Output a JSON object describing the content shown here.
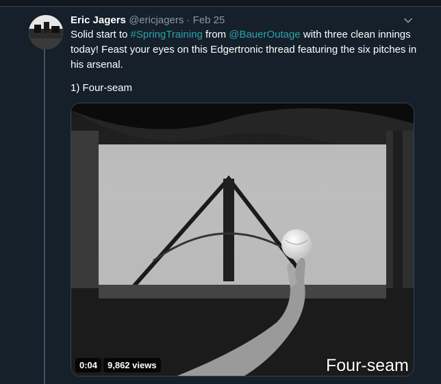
{
  "tweet": {
    "author_name": "Eric Jagers",
    "author_handle": "@ericjagers",
    "separator": "·",
    "date": "Feb 25",
    "text_parts": {
      "p1": "Solid start to ",
      "hashtag": "#SpringTraining",
      "p2": " from ",
      "mention": "@BauerOutage",
      "p3": " with three clean innings today! Feast your eyes on this Edgertronic thread featuring the six pitches in his arsenal."
    },
    "subline": "1) Four-seam"
  },
  "media": {
    "duration": "0:04",
    "views": "9,862 views",
    "caption": "Four-seam"
  },
  "icons": {
    "caret": "chevron-down-icon"
  },
  "colors": {
    "background": "#15202b",
    "link": "#2aa3a8",
    "muted": "#8899a6",
    "thread_line": "#3d5466"
  }
}
